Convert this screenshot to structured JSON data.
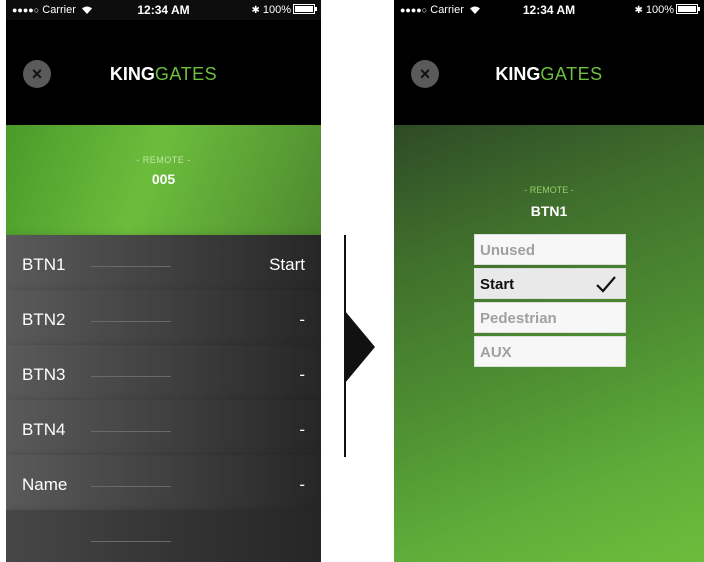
{
  "left_screen": {
    "status": {
      "carrier": "Carrier",
      "time": "12:34 AM",
      "battery": "100%"
    },
    "brand": {
      "king": "KING",
      "gates": "GATES"
    },
    "remote": {
      "caption": "- REMOTE -",
      "value": "005"
    },
    "rows": [
      {
        "label": "BTN1",
        "value": "Start"
      },
      {
        "label": "BTN2",
        "value": "-"
      },
      {
        "label": "BTN3",
        "value": "-"
      },
      {
        "label": "BTN4",
        "value": "-"
      },
      {
        "label": "Name",
        "value": "-"
      }
    ]
  },
  "right_screen": {
    "status": {
      "carrier": "Carrier",
      "time": "12:34 AM",
      "battery": "100%"
    },
    "brand": {
      "king": "KING",
      "gates": "GATES"
    },
    "caption": "- REMOTE -",
    "title": "BTN1",
    "options": [
      {
        "label": "Unused",
        "selected": false
      },
      {
        "label": "Start",
        "selected": true
      },
      {
        "label": "Pedestrian",
        "selected": false
      },
      {
        "label": "AUX",
        "selected": false
      }
    ]
  },
  "colors": {
    "accent_green": "#6cbd3c",
    "dark": "#0d0d0d"
  }
}
